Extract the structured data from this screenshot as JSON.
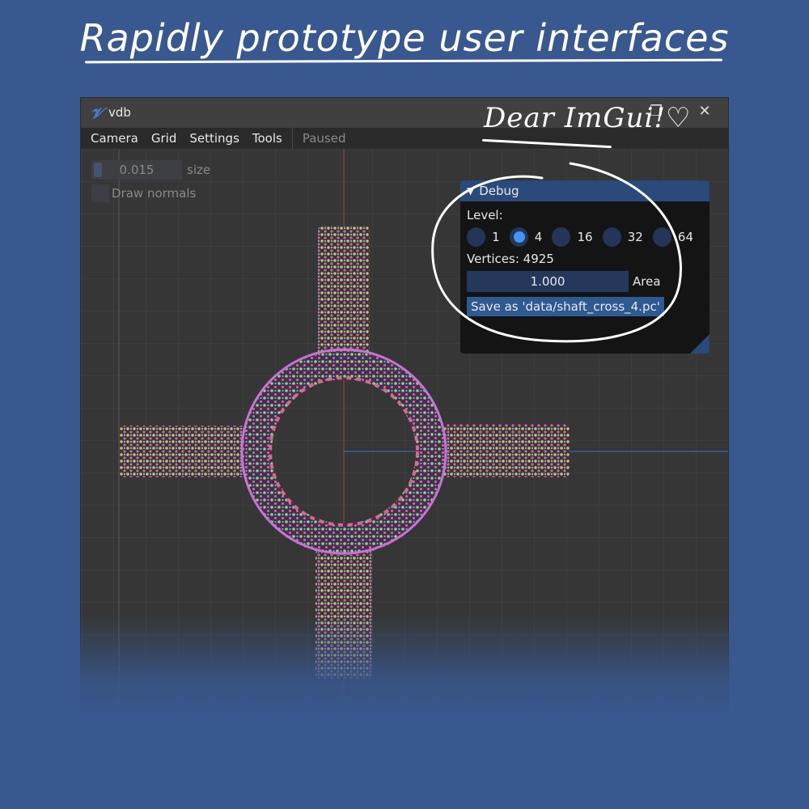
{
  "banner": {
    "headline": "Rapidly prototype user interfaces",
    "signature": "Dear ImGui!",
    "heart": "♡"
  },
  "window": {
    "logo": "𝓥",
    "title": "vdb",
    "restore_icon": "❐",
    "close_icon": "✕"
  },
  "menubar": {
    "items": [
      "Camera",
      "Grid",
      "Settings",
      "Tools"
    ],
    "status": "Paused"
  },
  "overlay": {
    "size_value": "0.015",
    "size_label": "size",
    "normals_label": "Draw normals"
  },
  "debug_panel": {
    "title": "Debug",
    "level_label": "Level:",
    "levels": [
      "1",
      "4",
      "16",
      "32",
      "64"
    ],
    "selected_level": "4",
    "vertices_text": "Vertices: 4925",
    "area_value": "1.000",
    "area_label": "Area",
    "save_button": "Save as 'data/shaft_cross_4.pc'"
  },
  "colors": {
    "background": "#38588f",
    "panel_title": "#294a7a",
    "accent": "#4296fa"
  }
}
